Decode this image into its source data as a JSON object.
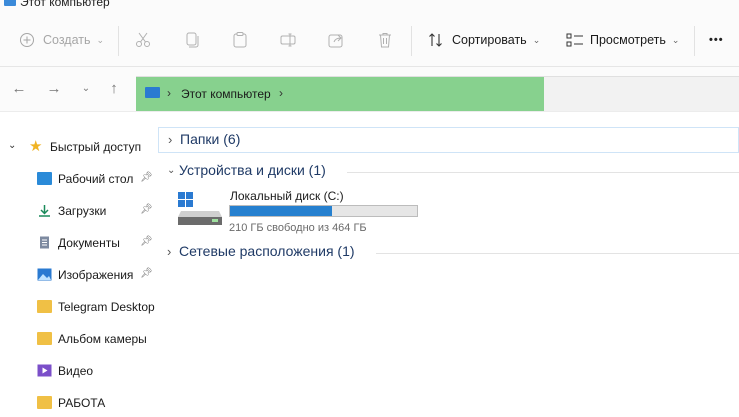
{
  "window": {
    "title": "Этот компьютер"
  },
  "toolbar": {
    "create_label": "Создать",
    "sort_label": "Сортировать",
    "view_label": "Просмотреть",
    "more_label": "•••"
  },
  "address": {
    "crumb": "Этот компьютер",
    "highlight_color": "#87d18e"
  },
  "sidebar": {
    "quick_access": "Быстрый доступ",
    "items": [
      {
        "label": "Рабочий стол",
        "icon": "desktop-icon",
        "pinned": true
      },
      {
        "label": "Загрузки",
        "icon": "download-icon",
        "pinned": true
      },
      {
        "label": "Документы",
        "icon": "documents-icon",
        "pinned": true
      },
      {
        "label": "Изображения",
        "icon": "pictures-icon",
        "pinned": true
      },
      {
        "label": "Telegram Desktop",
        "icon": "folder-icon",
        "pinned": false
      },
      {
        "label": "Альбом камеры",
        "icon": "folder-icon",
        "pinned": false
      },
      {
        "label": "Видео",
        "icon": "video-icon",
        "pinned": false
      },
      {
        "label": "РАБОТА",
        "icon": "folder-icon",
        "pinned": false
      }
    ]
  },
  "content": {
    "groups": [
      {
        "label": "Папки (6)",
        "expanded": false
      },
      {
        "label": "Устройства и диски (1)",
        "expanded": true
      },
      {
        "label": "Сетевые расположения (1)",
        "expanded": false
      }
    ],
    "drive": {
      "name": "Локальный диск (C:)",
      "free_text": "210 ГБ свободно из 464 ГБ",
      "used_fraction": 0.547,
      "bar_color": "#2680cf"
    }
  }
}
